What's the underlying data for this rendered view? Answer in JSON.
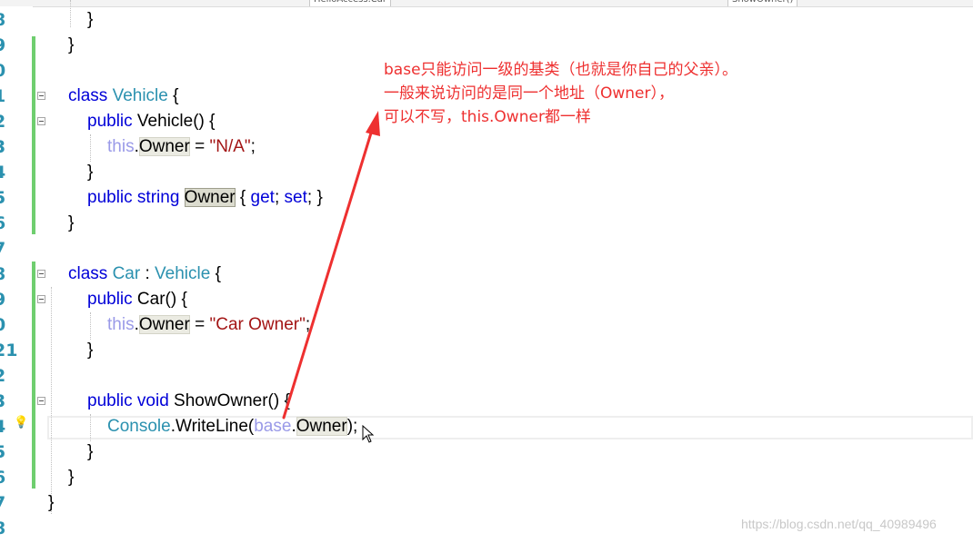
{
  "nav_bar": {
    "left_dropdown": "HelloAccess.Car",
    "right_dropdown": "ShowOwner()"
  },
  "line_numbers": [
    "8",
    "9",
    "0",
    "1",
    "2",
    "3",
    "4",
    "5",
    "6",
    "7",
    "8",
    "9",
    "0",
    "21",
    "2",
    "3",
    "4",
    "5",
    "6",
    "7",
    "8"
  ],
  "code": {
    "l8_brace": "}",
    "l9_brace": "}",
    "l11_kw": "class",
    "l11_type": "Vehicle",
    "l11_brace": " {",
    "l12_kw": "public",
    "l12_name": " Vehicle() {",
    "l13_this": "this",
    "l13_dot": ".",
    "l13_prop": "Owner",
    "l13_eq": " = ",
    "l13_str": "\"N/A\"",
    "l13_semi": ";",
    "l14_brace": "}",
    "l15_kw": "public string",
    "l15_prop": "Owner",
    "l15_brace1": " { ",
    "l15_get": "get",
    "l15_semi1": "; ",
    "l15_set": "set",
    "l15_brace2": "; }",
    "l16_brace": "}",
    "l18_kw": "class",
    "l18_type": "Car",
    "l18_colon": " : ",
    "l18_base": "Vehicle",
    "l18_brace": " {",
    "l19_kw": "public",
    "l19_name": " Car() {",
    "l20_this": "this",
    "l20_dot": ".",
    "l20_prop": "Owner",
    "l20_eq": " = ",
    "l20_str": "\"Car Owner\"",
    "l20_semi": ";",
    "l21_brace": "}",
    "l23_kw": "public void",
    "l23_name": " ShowOwner() {",
    "l24_type": "Console",
    "l24_call": ".WriteLine(",
    "l24_base": "base",
    "l24_dot": ".",
    "l24_prop": "Owner",
    "l24_end": ");",
    "l25_brace": "}",
    "l26_brace": "}",
    "l27_brace": "}"
  },
  "annotation": {
    "line1": "base只能访问一级的基类（也就是你自己的父亲）。",
    "line2": "一般来说访问的是同一个地址（Owner），",
    "line3": "可以不写，this.Owner都一样"
  },
  "watermark": "https://blog.csdn.net/qq_40989496",
  "colors": {
    "keyword": "#0000d8",
    "type": "#2b91af",
    "string": "#a31515",
    "this_keyword": "#9a9ae8",
    "annotation": "#ee3030",
    "change_bar": "#6fce6f"
  }
}
